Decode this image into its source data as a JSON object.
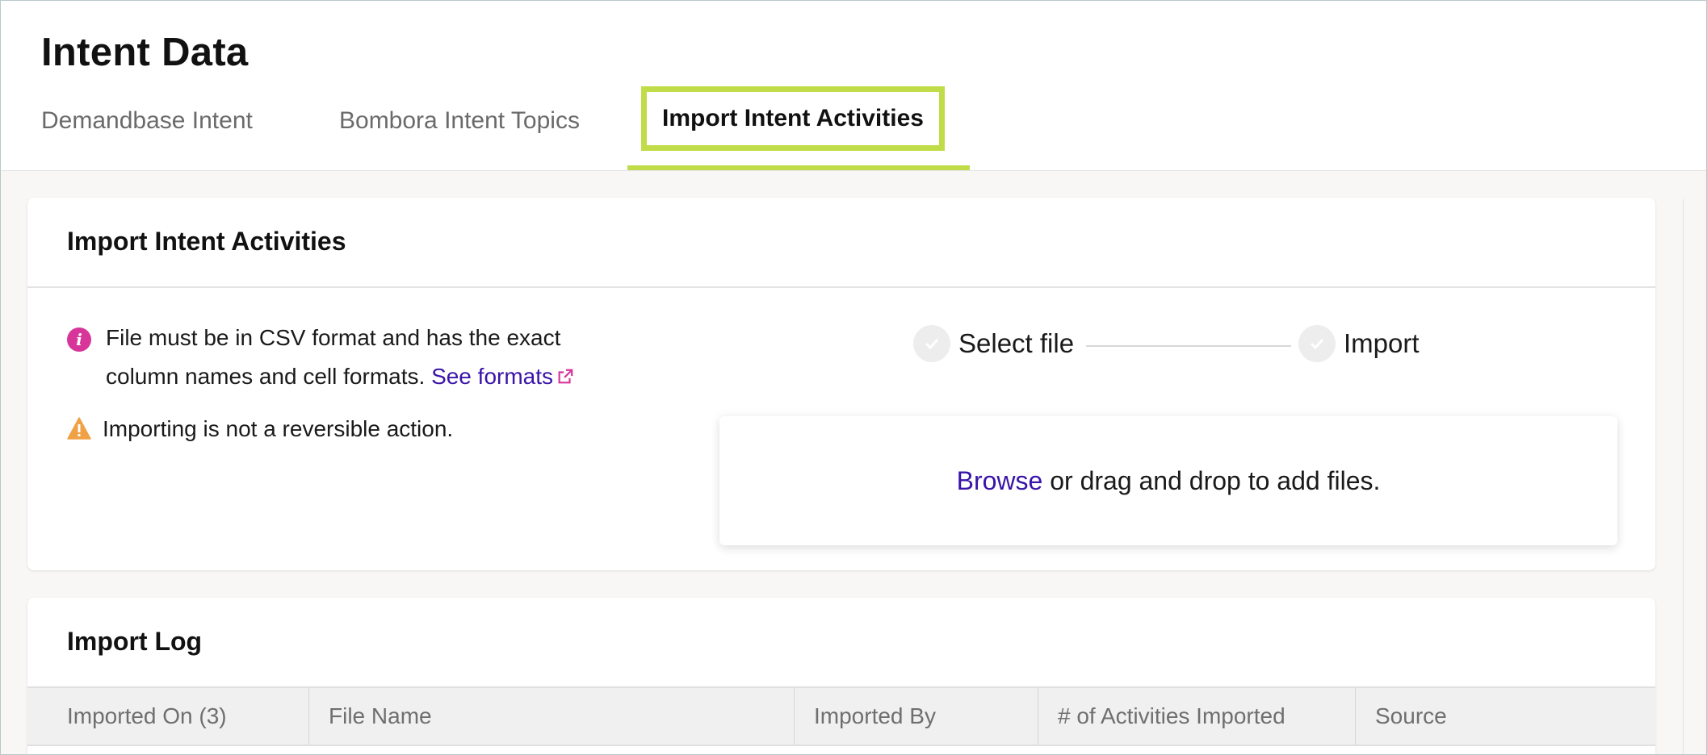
{
  "header": {
    "title": "Intent Data",
    "tabs": [
      {
        "label": "Demandbase Intent"
      },
      {
        "label": "Bombora Intent Topics"
      },
      {
        "label": "Import Intent Activities"
      }
    ]
  },
  "import_card": {
    "title": "Import Intent Activities",
    "info_text_1": "File must be in CSV format and has the exact column names and cell formats.",
    "see_formats_label": "See formats",
    "warning_text": "Importing is not a reversible action.",
    "steps": [
      {
        "label": "Select file"
      },
      {
        "label": "Import"
      }
    ],
    "dropzone": {
      "browse_label": "Browse",
      "text": "or drag and drop to add files."
    }
  },
  "log_card": {
    "title": "Import Log",
    "columns": [
      {
        "label": "Imported On (3)"
      },
      {
        "label": "File Name"
      },
      {
        "label": "Imported By"
      },
      {
        "label": "# of Activities Imported"
      },
      {
        "label": "Source"
      }
    ]
  },
  "colors": {
    "accent_tab": "#c0dc48",
    "link": "#3a14a8",
    "info_icon": "#d8359a",
    "warning_icon": "#f0a145"
  },
  "icons": {
    "info": "info-icon",
    "external_link": "external-link-icon",
    "warning": "warning-icon",
    "step_check": "check-icon"
  }
}
